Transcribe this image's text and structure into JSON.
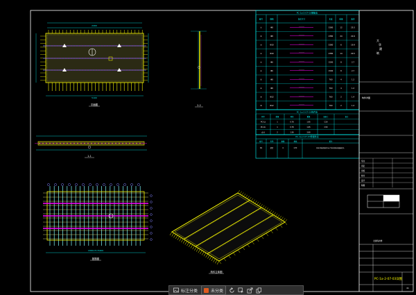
{
  "colors": {
    "background": "#000000",
    "frame": "#ffffff",
    "table_line": "#00ffff",
    "dim": "#00ffff",
    "rebar_main": "#ffff00",
    "rebar_dist": "#8080ff",
    "rebar_alt": "#ff00ff",
    "panel_green": "#00ff00",
    "tag_color": "#ffff00"
  },
  "views": {
    "plan_label": "平面图",
    "side_label": "2-2",
    "section_label": "1-1",
    "rebar_plan_label": "配筋图",
    "iso_label": "构件立体图",
    "plan_dim_top": "2400",
    "plan_dim_bottom": "5100",
    "rebar_dim_bottom": "1800×5=5400"
  },
  "table_main": {
    "title": "PC-1a-2-07-03钢筋表",
    "headers": [
      "编号",
      "规格",
      "数量",
      "长度",
      "加工尺寸",
      "重量",
      "备注"
    ],
    "rows": [
      [
        "①",
        "Φ8",
        "12",
        "5380",
        "————",
        "25.5",
        ""
      ],
      [
        "②",
        "Φ8",
        "24",
        "2380",
        "————",
        "22.6",
        ""
      ],
      [
        "③",
        "Φ10",
        "6",
        "5380",
        "————",
        "19.9",
        ""
      ],
      [
        "④",
        "Φ10",
        "14",
        "2380",
        "————",
        "20.5",
        ""
      ],
      [
        "⑤",
        "Φ6",
        "8",
        "1500",
        "————",
        "2.7",
        ""
      ],
      [
        "⑥",
        "Φ6",
        "8",
        "1500",
        "————",
        "2.7",
        ""
      ],
      [
        "⑦",
        "Φ8",
        "4",
        "760",
        "————",
        "1.2",
        ""
      ],
      [
        "⑧",
        "Φ8",
        "4",
        "760",
        "————",
        "1.2",
        ""
      ],
      [
        "⑨",
        "Φ12",
        "2",
        "760",
        "————",
        "1.4",
        ""
      ],
      [
        "⑩",
        "Φ12",
        "2",
        "760",
        "————",
        "1.4",
        ""
      ]
    ]
  },
  "table_small": {
    "title": "PC-1a-2-07-03构件表",
    "headers": [
      "构件",
      "数量",
      "体积",
      "重量",
      "混凝土",
      "备注"
    ],
    "rows": [
      [
        "PC-1a",
        "1",
        "0.78",
        "1.95",
        "C30",
        ""
      ],
      [
        "PC-1b",
        "1",
        "0.78",
        "1.95",
        "C30",
        ""
      ],
      [
        "合计",
        "2",
        "1.56",
        "3.90",
        "",
        ""
      ]
    ]
  },
  "table_note": {
    "title": "PC-1a-2-07-03预埋件表",
    "headers": [
      "编号",
      "名称",
      "数量",
      "规格",
      "备注"
    ],
    "row": [
      "D1",
      "吊钉",
      "4",
      "2.5t",
      "吊装时须使用配套吊具,严禁采用钢丝绳直接起吊。"
    ]
  },
  "title_block": {
    "company_chars": [
      "大",
      "华",
      "建",
      "筑"
    ],
    "note": "构件详图",
    "row_labels": [
      "专业",
      "审定",
      "审核",
      "校对",
      "设计",
      "制图"
    ],
    "stamp": "出图专用章",
    "drawing_name": "PC-1a-2-07-03详图",
    "sheet_no": "41"
  },
  "toolbar": {
    "annotation_label": "标注分类",
    "category_label": "未分类",
    "category_color": "#e05a1e",
    "icons": [
      "rotate-icon",
      "select-icon",
      "share-icon",
      "copy-icon"
    ]
  }
}
